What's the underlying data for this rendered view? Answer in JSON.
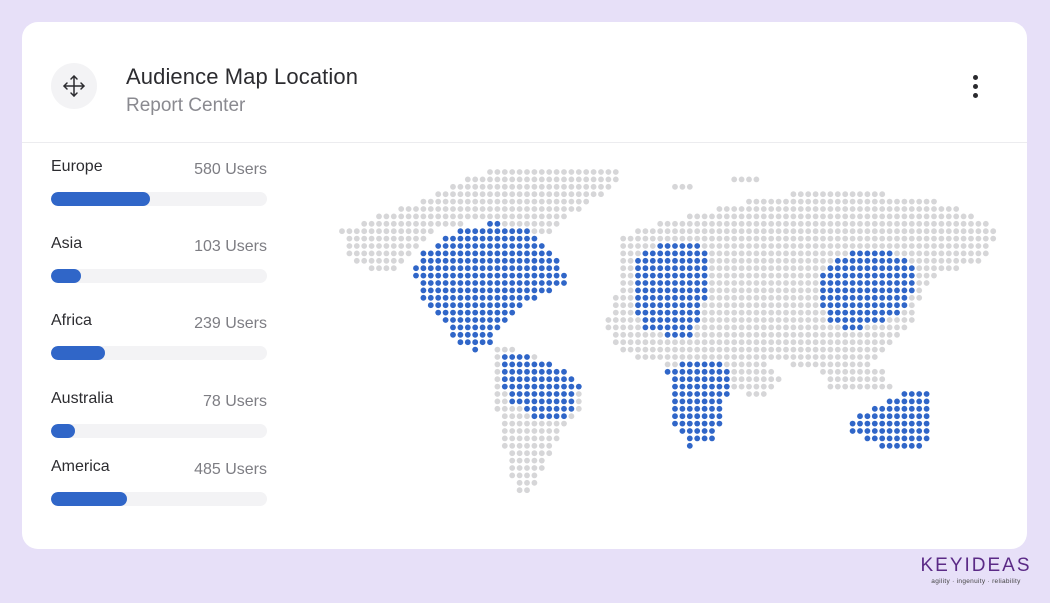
{
  "header": {
    "title": "Audience Map Location",
    "subtitle": "Report Center",
    "move_icon": "move-arrows-icon",
    "menu_icon": "kebab-menu-icon"
  },
  "regions": [
    {
      "name": "Europe",
      "users": "580 Users",
      "fill_percent": 46
    },
    {
      "name": "Asia",
      "users": "103 Users",
      "fill_percent": 14
    },
    {
      "name": "Africa",
      "users": "239 Users",
      "fill_percent": 25
    },
    {
      "name": "Australia",
      "users": "78 Users",
      "fill_percent": 11
    },
    {
      "name": "America",
      "users": "485 Users",
      "fill_percent": 35
    }
  ],
  "map": {
    "dot_color": "#d6d6d8",
    "highlight_color": "#3066c8"
  },
  "brand": {
    "name": "KEYIDEAS",
    "tagline": "agility · ingenuity · reliability"
  }
}
